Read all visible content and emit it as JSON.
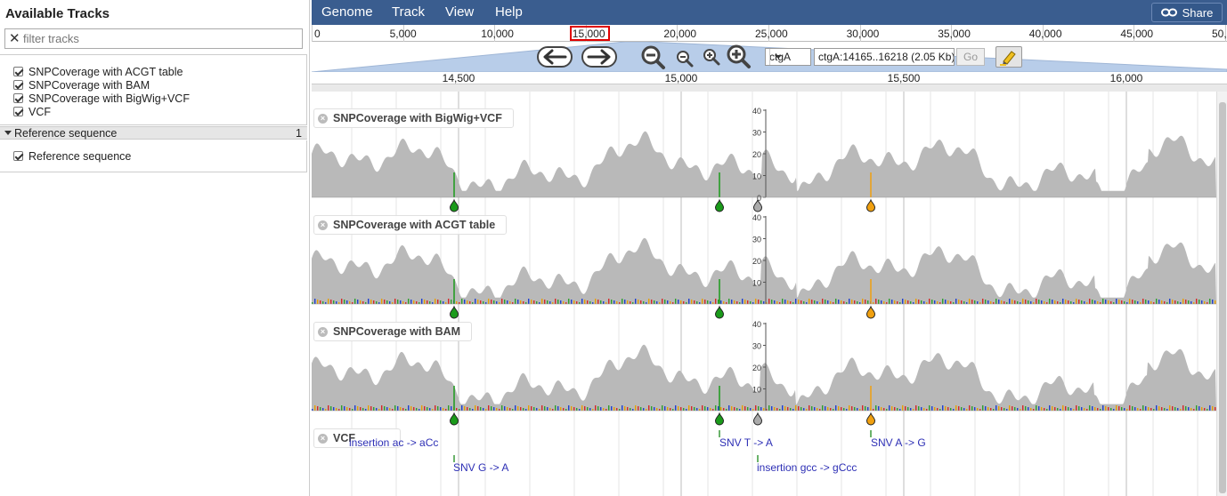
{
  "left_panel": {
    "title": "Available Tracks",
    "filter_placeholder": "filter tracks",
    "tracks": [
      {
        "label": "SNPCoverage with ACGT table",
        "checked": true
      },
      {
        "label": "SNPCoverage with BAM",
        "checked": true
      },
      {
        "label": "SNPCoverage with BigWig+VCF",
        "checked": true
      },
      {
        "label": "VCF",
        "checked": true
      }
    ],
    "category": {
      "label": "Reference sequence",
      "count": "1"
    },
    "category_tracks": [
      {
        "label": "Reference sequence",
        "checked": true
      }
    ]
  },
  "menu": {
    "items": [
      "Genome",
      "Track",
      "View",
      "Help"
    ],
    "share_label": "Share"
  },
  "overview": {
    "ticks": [
      "0",
      "5,000",
      "10,000",
      "15,000",
      "20,000",
      "25,000",
      "30,000",
      "35,000",
      "40,000",
      "45,000",
      "50,0"
    ]
  },
  "navigation": {
    "refseq": "ctgA",
    "location": "ctgA:14165..16218 (2.05 Kb)",
    "go_label": "Go"
  },
  "ruler": {
    "labels": [
      "14,500",
      "15,000",
      "15,500",
      "16,000"
    ]
  },
  "tracks": [
    {
      "name": "SNPCoverage with BigWig+VCF",
      "axis_labels": [
        "40",
        "30",
        "20",
        "10",
        "0"
      ]
    },
    {
      "name": "SNPCoverage with ACGT table",
      "axis_labels": [
        "40",
        "30",
        "20",
        "10"
      ]
    },
    {
      "name": "SNPCoverage with BAM",
      "axis_labels": [
        "40",
        "30",
        "20",
        "10"
      ]
    },
    {
      "name": "VCF"
    }
  ],
  "vcf_features": [
    {
      "label": "insertion ac -> aCc"
    },
    {
      "label": "SNV G -> A"
    },
    {
      "label": "SNV T -> A"
    },
    {
      "label": "insertion gcc -> gCcc"
    },
    {
      "label": "SNV A -> G"
    }
  ],
  "colors": {
    "menubar": "#3a5d8f",
    "coverage": "#b9b9b9",
    "snv_green": "#1a9a1a",
    "snv_orange": "#f0a010",
    "insertion_gray": "#aaaaaa",
    "vcf_text": "#2d2fb5"
  }
}
